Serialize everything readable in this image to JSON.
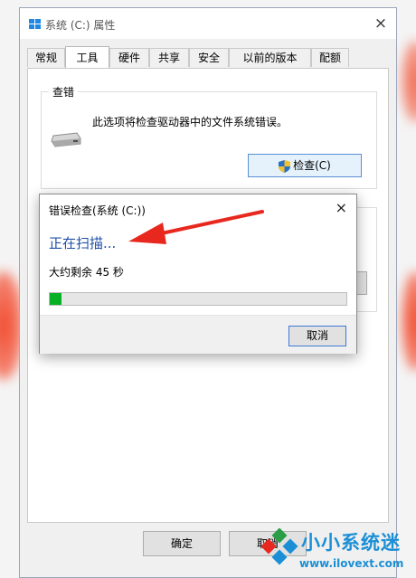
{
  "window": {
    "title": "系统 (C:) 属性",
    "close_glyph": "×"
  },
  "tabs": [
    {
      "label": "常规"
    },
    {
      "label": "工具"
    },
    {
      "label": "硬件"
    },
    {
      "label": "共享"
    },
    {
      "label": "安全"
    },
    {
      "label": "以前的版本"
    },
    {
      "label": "配额"
    }
  ],
  "active_tab": "工具",
  "error_check_group": {
    "label": "查错",
    "description": "此选项将检查驱动器中的文件系统错误。",
    "check_button": "检查(C)"
  },
  "footer": {
    "ok_button": "确定",
    "cancel_button": "取消"
  },
  "dialog": {
    "title": "错误检查(系统 (C:))",
    "close_glyph": "×",
    "heading": "正在扫描...",
    "remaining": "大约剩余 45 秒",
    "progress_fraction": 0.04,
    "cancel_button": "取消"
  },
  "watermark": {
    "brand": "小小系统迷",
    "url": "www.ilovext.com"
  },
  "colors": {
    "accent_blue": "#1f4fa8",
    "progress_green": "#06b025",
    "arrow_red": "#e8281e",
    "watermark_blue": "#1a8fd6"
  }
}
